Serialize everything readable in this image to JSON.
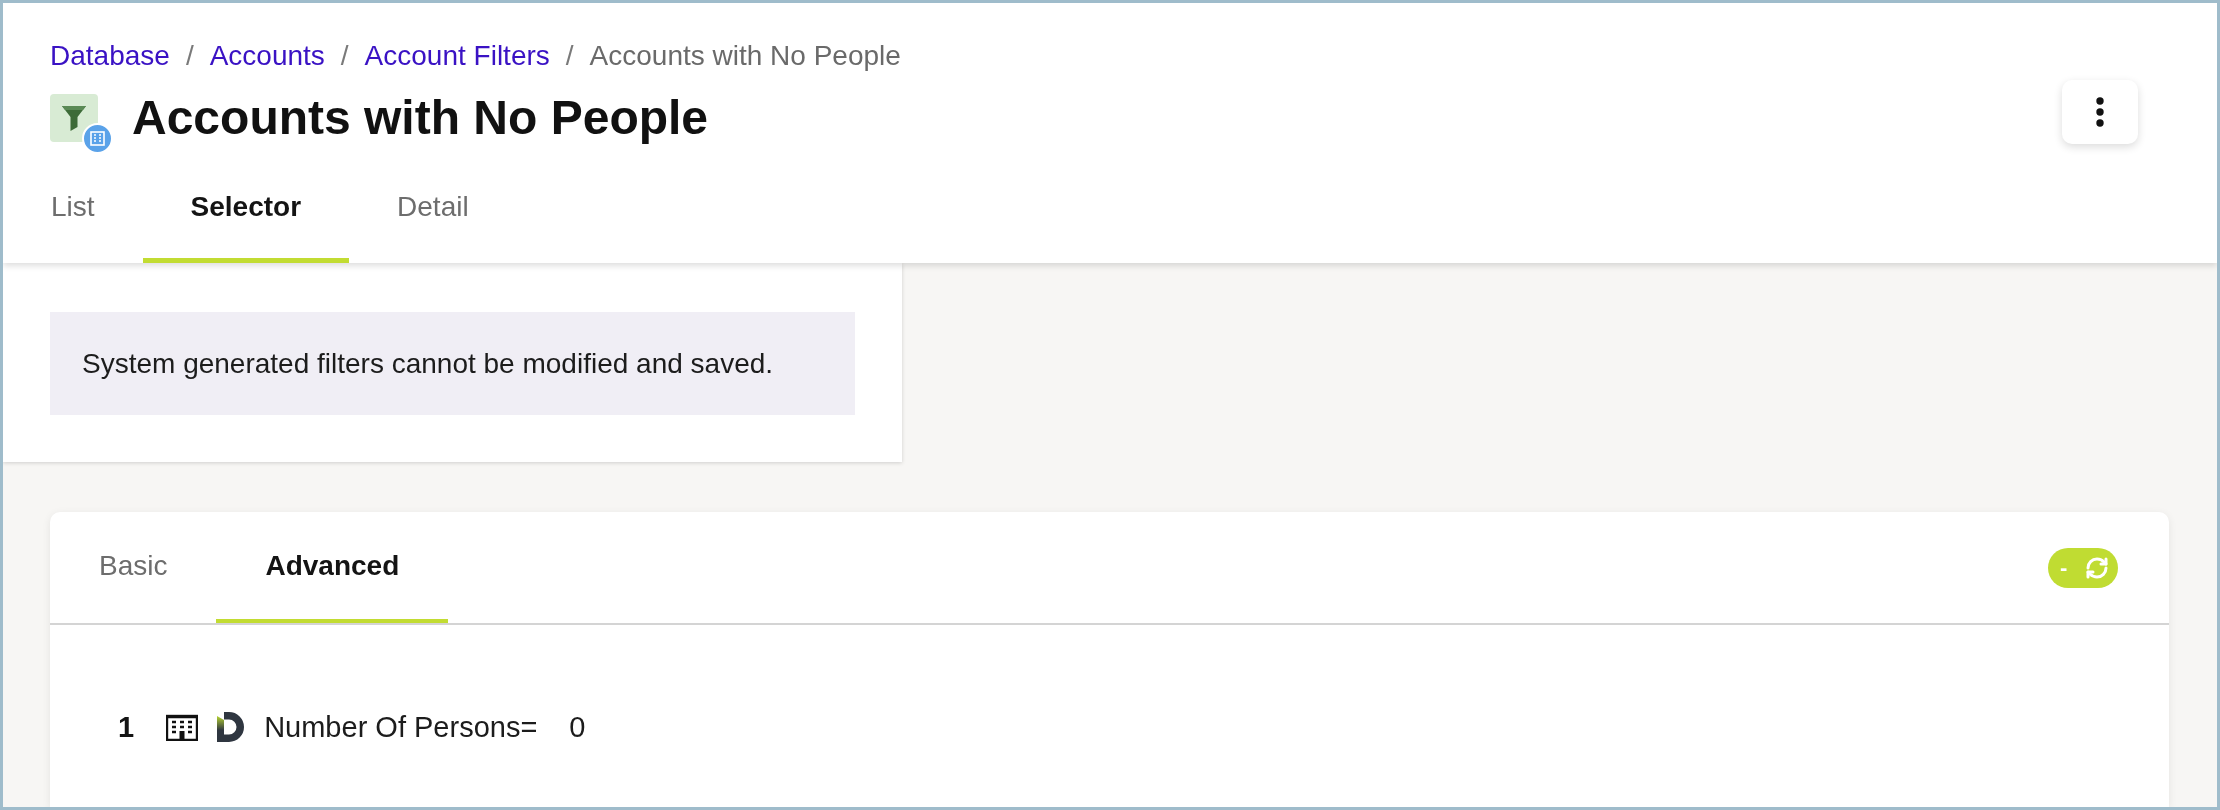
{
  "breadcrumb": [
    {
      "kind": "link",
      "label": "Database"
    },
    {
      "kind": "separator",
      "label": "/"
    },
    {
      "kind": "link",
      "label": "Accounts"
    },
    {
      "kind": "separator",
      "label": "/"
    },
    {
      "kind": "link",
      "label": "Account Filters"
    },
    {
      "kind": "separator",
      "label": "/"
    },
    {
      "kind": "current",
      "label": "Accounts with No People"
    }
  ],
  "page": {
    "title": "Accounts with No People"
  },
  "tabs": [
    {
      "label": "List",
      "selected": false
    },
    {
      "label": "Selector",
      "selected": true
    },
    {
      "label": "Detail",
      "selected": false
    }
  ],
  "notice": {
    "text": "System generated filters cannot be modified and saved."
  },
  "selector": {
    "tabs": [
      {
        "label": "Basic",
        "selected": false
      },
      {
        "label": "Advanced",
        "selected": true
      }
    ],
    "toggle": {
      "label": "-",
      "on": true
    },
    "conditions": [
      {
        "number": "1",
        "label": "Number Of Persons=",
        "value": "0"
      }
    ]
  }
}
